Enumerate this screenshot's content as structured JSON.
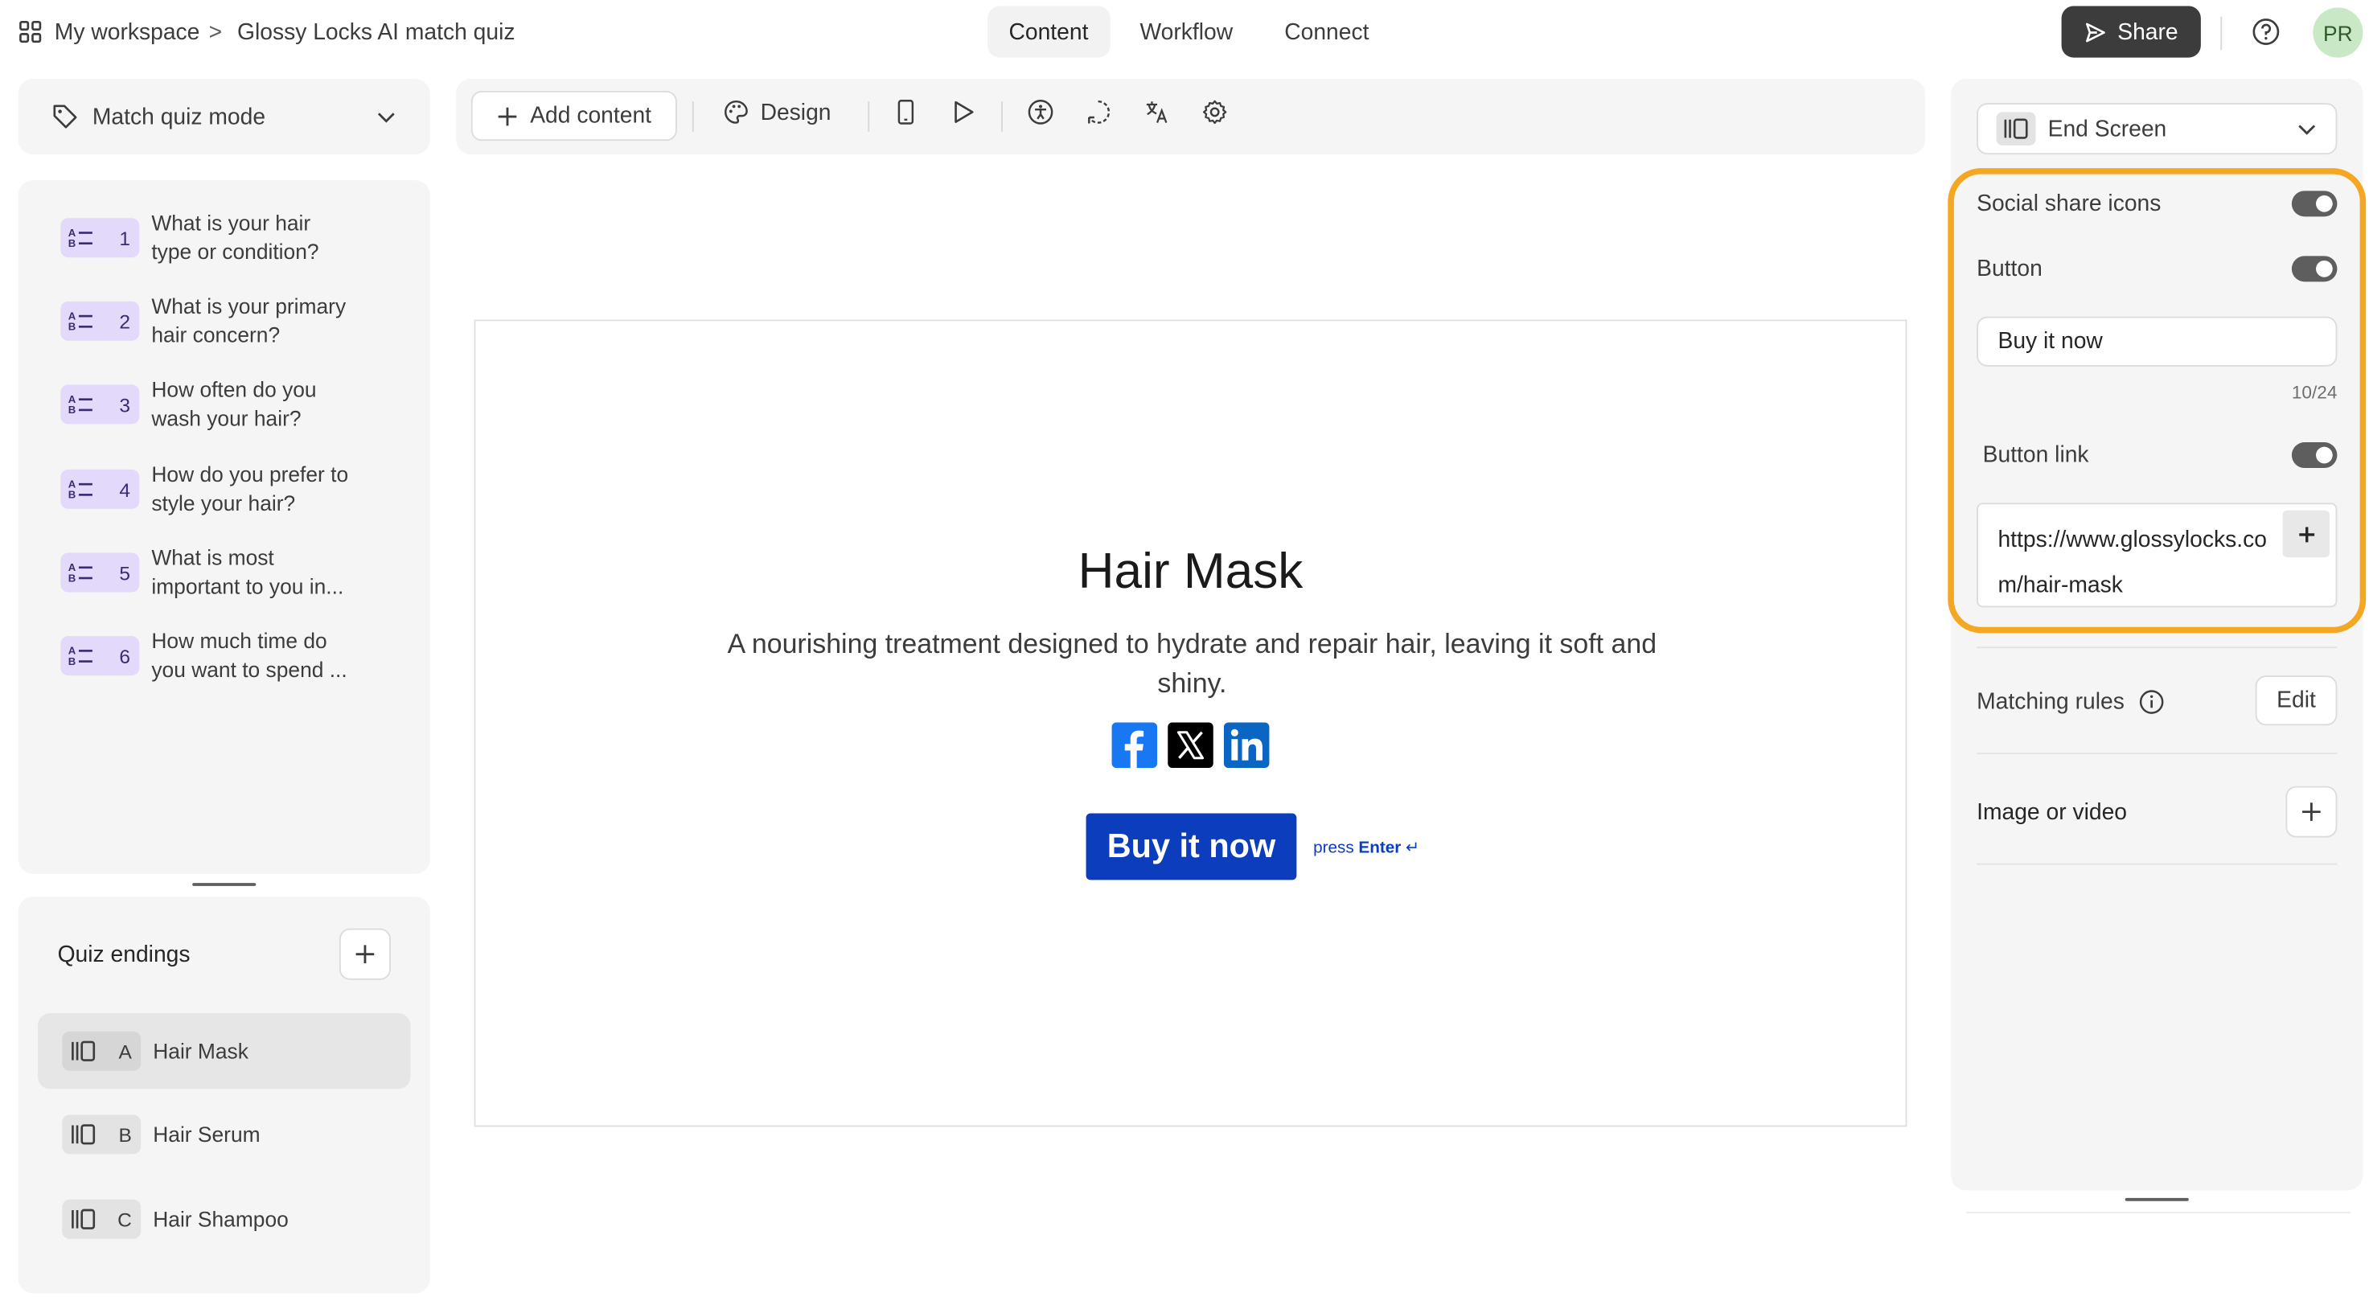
{
  "breadcrumb": {
    "workspace": "My workspace",
    "separator": ">",
    "form_name": "Glossy Locks AI match quiz"
  },
  "topnav": {
    "tabs": [
      "Content",
      "Workflow",
      "Connect"
    ],
    "active": "Content"
  },
  "share_label": "Share",
  "avatar_initials": "PR",
  "mode_selector": {
    "label": "Match quiz mode"
  },
  "questions": [
    {
      "number": "1",
      "text": [
        "What is your hair",
        "type or condition?"
      ]
    },
    {
      "number": "2",
      "text": [
        "What is your primary",
        "hair concern?"
      ]
    },
    {
      "number": "3",
      "text": [
        "How often do you",
        "wash your hair?"
      ]
    },
    {
      "number": "4",
      "text": [
        "How do you prefer to",
        "style your hair?"
      ]
    },
    {
      "number": "5",
      "text": [
        "What is most",
        "important to you in..."
      ]
    },
    {
      "number": "6",
      "text": [
        "How much time do",
        "you want to spend ..."
      ]
    }
  ],
  "endings": {
    "title": "Quiz endings",
    "items": [
      {
        "letter": "A",
        "label": "Hair Mask",
        "active": true
      },
      {
        "letter": "B",
        "label": "Hair Serum",
        "active": false
      },
      {
        "letter": "C",
        "label": "Hair Shampoo",
        "active": false
      }
    ]
  },
  "toolbar": {
    "add_content_label": "Add content",
    "design_label": "Design"
  },
  "preview": {
    "title": "Hair Mask",
    "description": "A nourishing treatment designed to hydrate and repair hair, leaving it soft and shiny.",
    "button_label": "Buy it now",
    "press_hint": "press",
    "press_key": "Enter",
    "press_symbol": "↵",
    "social_icons": [
      "facebook-icon",
      "x-icon",
      "linkedin-icon"
    ]
  },
  "settings": {
    "screen_type": "End Screen",
    "social_share_label": "Social share icons",
    "social_share_on": true,
    "button_label": "Button",
    "button_on": true,
    "button_text_value": "Buy it now",
    "button_text_counter": "10/24",
    "button_link_label": "Button link",
    "button_link_on": true,
    "button_link_value": "https://www.glossylocks.com/hair-mask",
    "matching_rules_label": "Matching rules",
    "edit_label": "Edit",
    "image_video_label": "Image or video"
  },
  "colors": {
    "accent_blue": "#0b3dbd",
    "highlight_orange": "#f5a623",
    "question_badge": "#e3d9fb",
    "facebook": "#1877f2",
    "linkedin": "#0a66c2"
  }
}
